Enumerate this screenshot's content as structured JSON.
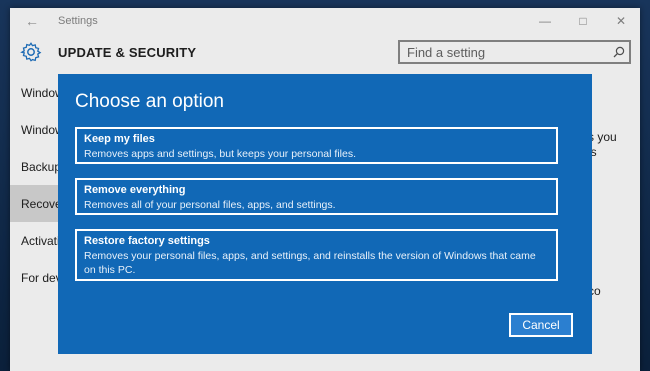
{
  "window": {
    "title": "Settings"
  },
  "header": {
    "title": "UPDATE & SECURITY",
    "search_placeholder": "Find a setting"
  },
  "sidebar": {
    "items": [
      {
        "label": "Window"
      },
      {
        "label": "Window"
      },
      {
        "label": "Backup"
      },
      {
        "label": "Recove"
      },
      {
        "label": "Activati"
      },
      {
        "label": "For dev"
      }
    ]
  },
  "content": {
    "frag1": "s you",
    "frag2": "ls",
    "frag3": "co"
  },
  "dialog": {
    "title": "Choose an option",
    "options": [
      {
        "title": "Keep my files",
        "desc": "Removes apps and settings, but keeps your personal files."
      },
      {
        "title": "Remove everything",
        "desc": "Removes all of your personal files, apps, and settings."
      },
      {
        "title": "Restore factory settings",
        "desc": "Removes your personal files, apps, and settings, and reinstalls the version of Windows that came on this PC."
      }
    ],
    "cancel_label": "Cancel"
  },
  "colors": {
    "dialog_bg": "#1168b6",
    "accent": "#1f73c4"
  }
}
